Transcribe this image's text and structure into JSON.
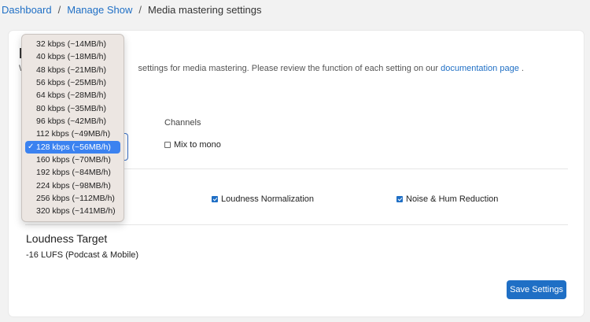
{
  "breadcrumb": {
    "items": [
      "Dashboard",
      "Manage Show"
    ],
    "current": "Media mastering settings",
    "separator": "/"
  },
  "page": {
    "title_visible": "M",
    "intro_prefix": "W",
    "intro_text": "settings for media mastering. Please review the function of each setting on our ",
    "intro_link": "documentation page",
    "intro_suffix": "."
  },
  "channels": {
    "label": "Channels",
    "mix_to_mono_label": "Mix to mono",
    "mix_to_mono_checked": false
  },
  "processing": {
    "loudness_normalization_label": "Loudness Normalization",
    "loudness_normalization_checked": true,
    "noise_reduction_label": "Noise & Hum Reduction",
    "noise_reduction_checked": true
  },
  "loudness": {
    "title": "Loudness Target",
    "value": "-16 LUFS (Podcast & Mobile)"
  },
  "actions": {
    "save_label": "Save Settings"
  },
  "bitrate_dropdown": {
    "selected_index": 6,
    "selected_mark": "✓",
    "options": [
      "32 kbps (~14MB/h)",
      "40 kbps (~18MB/h)",
      "48 kbps (~21MB/h)",
      "56 kbps (~25MB/h)",
      "64 kbps (~28MB/h)",
      "80 kbps (~35MB/h)",
      "96 kbps (~42MB/h)",
      "112 kbps (~49MB/h)",
      "128 kbps (~56MB/h)",
      "160 kbps (~70MB/h)",
      "192 kbps (~84MB/h)",
      "224 kbps (~98MB/h)",
      "256 kbps (~112MB/h)",
      "320 kbps (~141MB/h)"
    ]
  },
  "colors": {
    "accent": "#1f6fc5",
    "selected_item": "#3b82f0",
    "dropdown_bg": "#ece6e2"
  }
}
